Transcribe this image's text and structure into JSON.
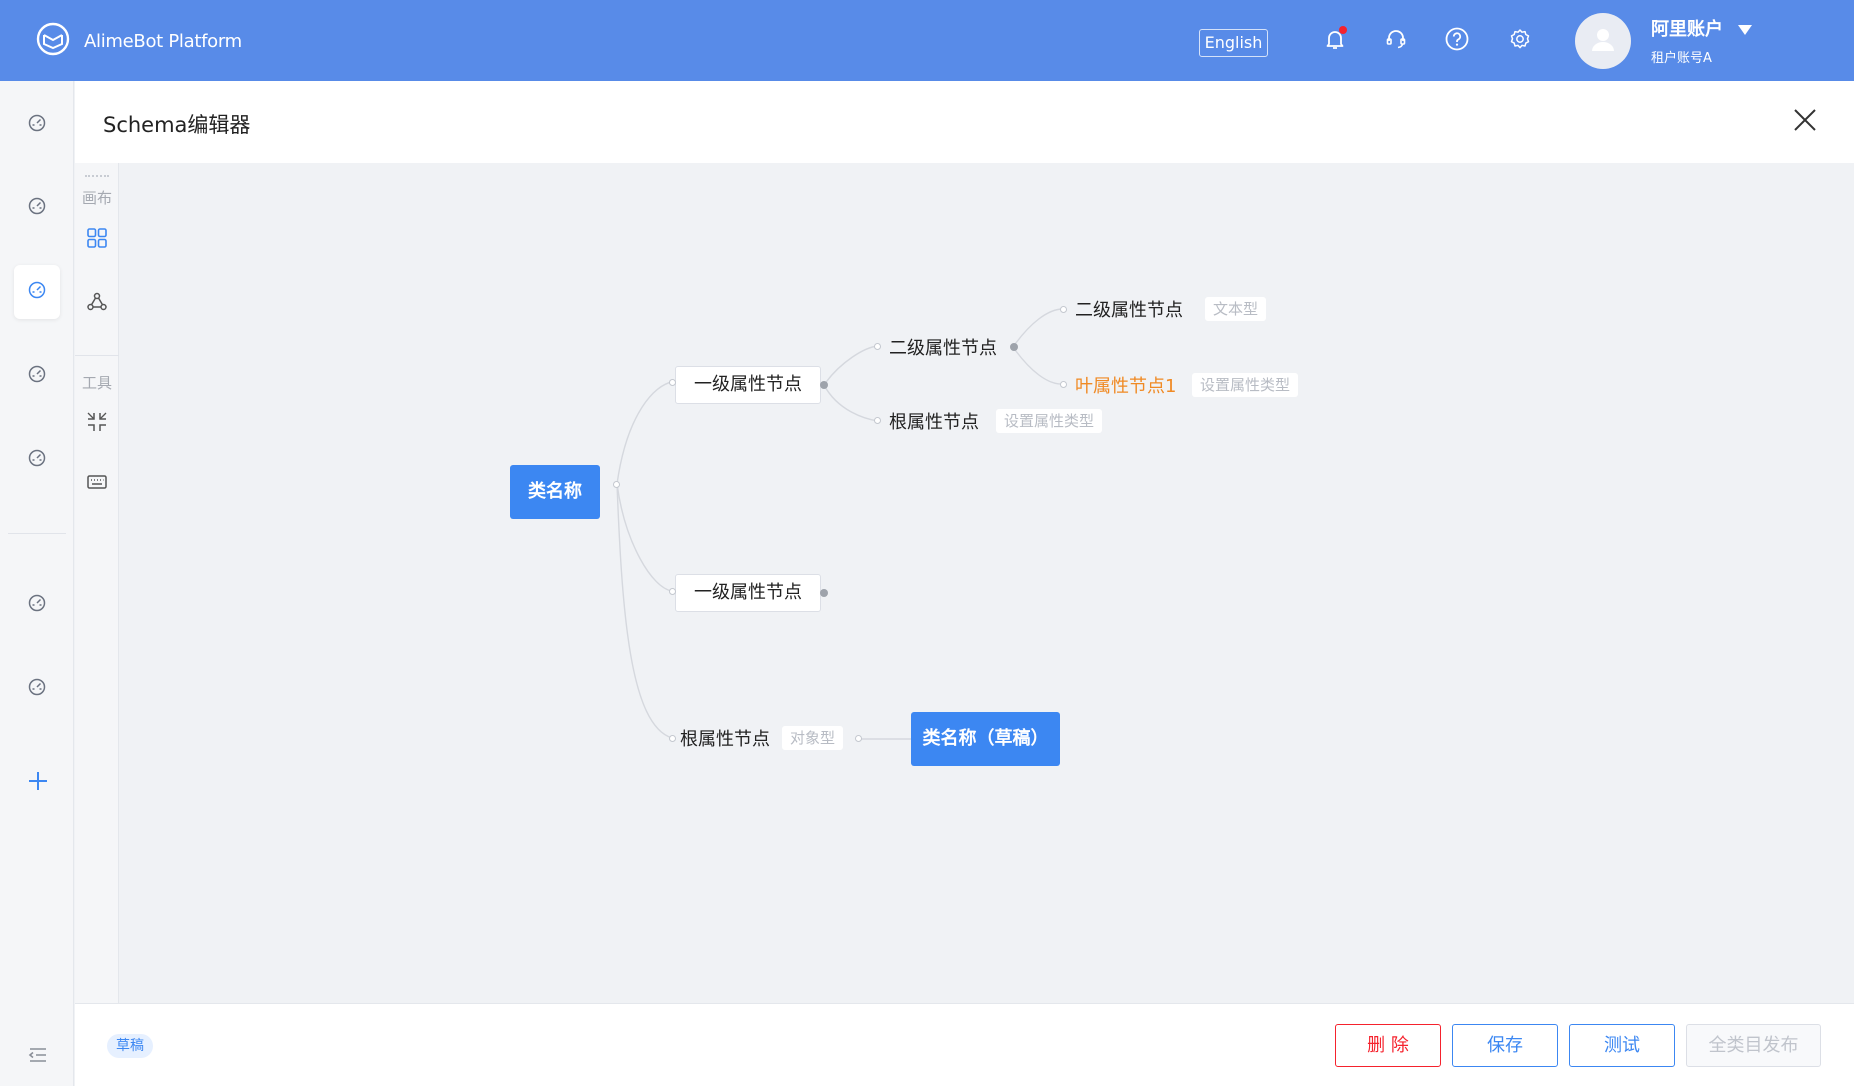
{
  "app": {
    "brand_name": "AlimeBot Platform"
  },
  "header": {
    "language_label": "English",
    "account_name": "阿里账户",
    "account_sub": "租户账号A"
  },
  "panel": {
    "title": "Schema编辑器"
  },
  "toolbar": {
    "canvas_section": "画布",
    "tools_section": "工具"
  },
  "schema_tree": {
    "root": "类名称",
    "level1_a": "一级属性节点",
    "level2_group": "二级属性节点",
    "level2_text": {
      "label": "二级属性节点",
      "type": "文本型"
    },
    "leaf": {
      "label": "叶属性节点1",
      "type": "设置属性类型"
    },
    "root_attr_a": {
      "label": "根属性节点",
      "type": "设置属性类型"
    },
    "level1_b": "一级属性节点",
    "root_attr_b": {
      "label": "根属性节点",
      "type": "对象型"
    },
    "draft_class": "类名称（草稿）"
  },
  "footer": {
    "status": "草稿",
    "delete_label": "删 除",
    "save_label": "保存",
    "test_label": "测试",
    "publish_label": "全类目发布"
  },
  "colors": {
    "topbar": "#588be8",
    "primary": "#3c87f2",
    "danger": "#f5222d",
    "leaf_highlight": "#f08a24"
  }
}
